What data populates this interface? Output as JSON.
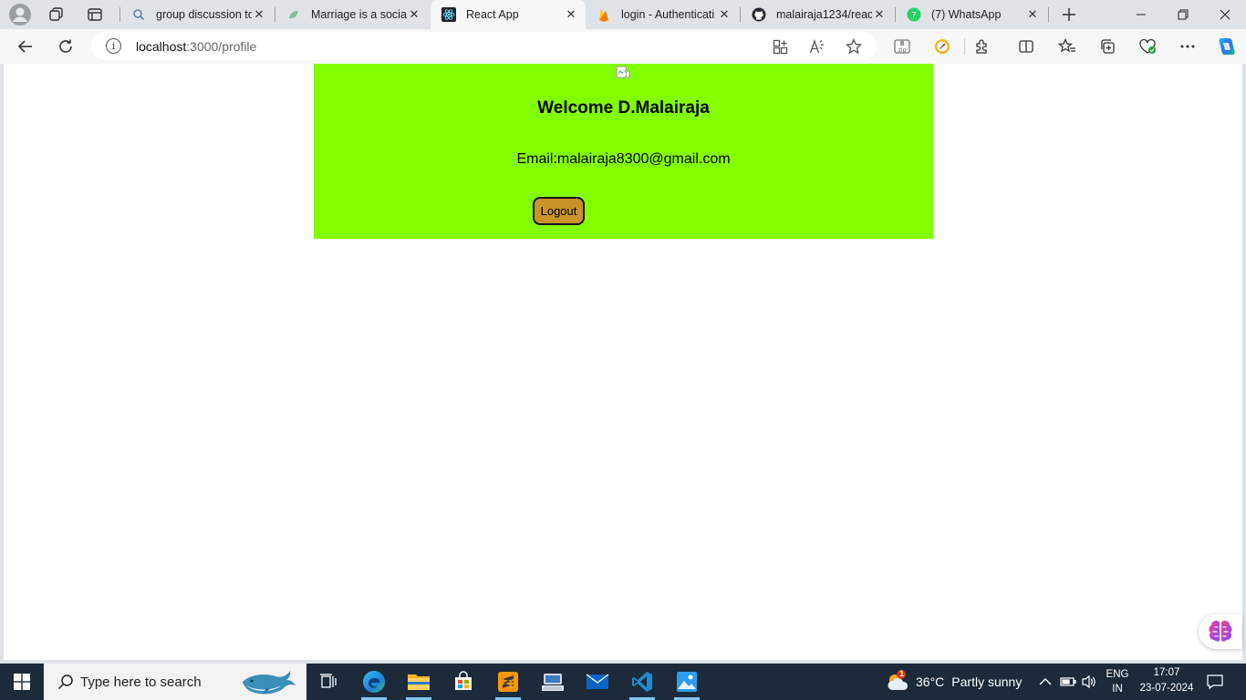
{
  "browser": {
    "tabs": [
      {
        "title": "group discussion to",
        "icon": "search-icon"
      },
      {
        "title": "Marriage is a social",
        "icon": "leaf-icon"
      },
      {
        "title": "React App",
        "icon": "react-icon",
        "active": true
      },
      {
        "title": "login - Authenticati",
        "icon": "firebase-icon"
      },
      {
        "title": "malairaja1234/react",
        "icon": "github-icon"
      },
      {
        "title": "(7) WhatsApp",
        "icon": "whatsapp-icon"
      }
    ],
    "address": {
      "host": "localhost",
      "path": ":3000/profile"
    }
  },
  "page": {
    "welcome": "Welcome D.Malairaja",
    "email": "Email:malairaja8300@gmail.com",
    "logout_label": "Logout",
    "card_color": "#84ff00",
    "button_color": "#c9922a"
  },
  "taskbar": {
    "search_placeholder": "Type here to search",
    "weather_temp": "36°C",
    "weather_desc": "Partly sunny",
    "weather_badge": "1",
    "lang_top": "ENG",
    "lang_bottom": "IN",
    "time": "17:07",
    "date": "23-07-2024"
  }
}
